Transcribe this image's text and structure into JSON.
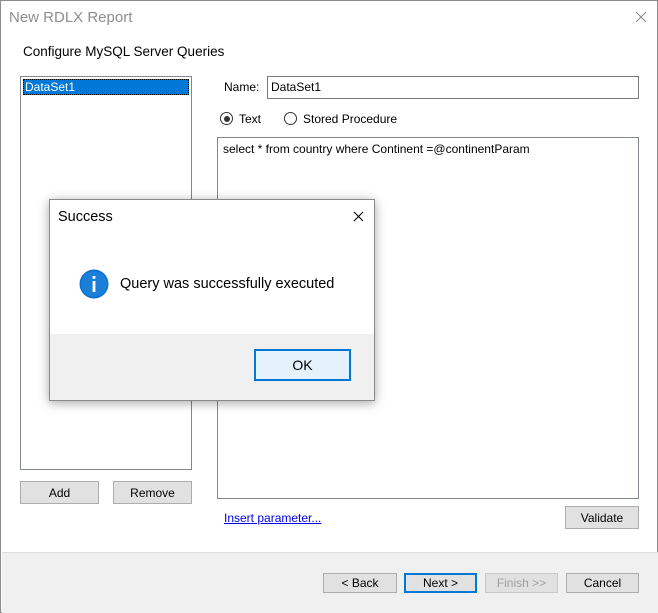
{
  "window": {
    "title": "New RDLX Report"
  },
  "wizard": {
    "subtitle": "Configure MySQL Server Queries"
  },
  "datasets": {
    "items": [
      "DataSet1"
    ],
    "selected": "DataSet1"
  },
  "buttons": {
    "add": "Add",
    "remove": "Remove",
    "validate": "Validate"
  },
  "form": {
    "name_label": "Name:",
    "name_value": "DataSet1",
    "radio_text": "Text",
    "radio_stored": "Stored Procedure",
    "query_text": "select * from country where Continent =@continentParam",
    "insert_param": "Insert parameter..."
  },
  "nav": {
    "back": "< Back",
    "next": "Next >",
    "finish": "Finish >>",
    "cancel": "Cancel"
  },
  "dialog": {
    "title": "Success",
    "message": "Query was successfully executed",
    "ok": "OK",
    "icon": "info-icon"
  },
  "colors": {
    "accent": "#0078d7",
    "selection": "#0078d7",
    "link": "#0000ee"
  }
}
